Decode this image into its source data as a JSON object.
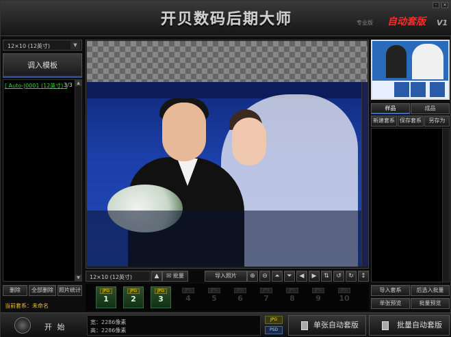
{
  "app": {
    "title": "开贝数码后期大师",
    "subtitle_left": "专业版",
    "auto_layout_label": "自动套版",
    "version": "V1",
    "min_btn": "-",
    "close_btn": "×"
  },
  "left": {
    "size_dropdown": "12×10 (12英寸)",
    "import_template_btn": "调入模板",
    "list_items": [
      {
        "name": "[ Auto-J0001 (12英寸) ]",
        "count": "3/3"
      }
    ],
    "buttons": {
      "delete": "删除",
      "delete_all": "全部删除",
      "photo_stats": "照片统计"
    },
    "current_set_label": "当前套系：未命名"
  },
  "canvas": {
    "size_field": "12×10 (12英寸)",
    "batch_label": "批量",
    "import_photo_btn": "导入照片"
  },
  "pages": {
    "format_chip": "JPG",
    "tiles": [
      {
        "num": "1",
        "active": true
      },
      {
        "num": "2",
        "active": true
      },
      {
        "num": "3",
        "active": true
      },
      {
        "num": "4",
        "active": false
      },
      {
        "num": "5",
        "active": false
      },
      {
        "num": "6",
        "active": false
      },
      {
        "num": "7",
        "active": false
      },
      {
        "num": "8",
        "active": false
      },
      {
        "num": "9",
        "active": false
      },
      {
        "num": "10",
        "active": false
      }
    ]
  },
  "right": {
    "tabs": {
      "sample": "样品",
      "finished": "成品"
    },
    "actions": {
      "new_set": "新建套系",
      "save_set": "保存套系",
      "save_as": "另存为"
    },
    "bottom_buttons": {
      "import_set": "导入套系",
      "batch_import": "后选入批量",
      "single_preview": "单张预览",
      "batch_preview": "批量预览"
    }
  },
  "bottom": {
    "start_label": "开 始",
    "width_label": "宽：2286像素",
    "height_label": "高：2286像素",
    "fmt_jpg": "JPG",
    "fmt_psd": "PSD",
    "single_auto_btn": "单张自动套版",
    "batch_auto_btn": "批量自动套版"
  },
  "colors": {
    "accent_blue": "#2a4a9a",
    "list_green": "#3cd43c",
    "status_yellow": "#e6c230",
    "auto_red": "#ff2a2a"
  }
}
